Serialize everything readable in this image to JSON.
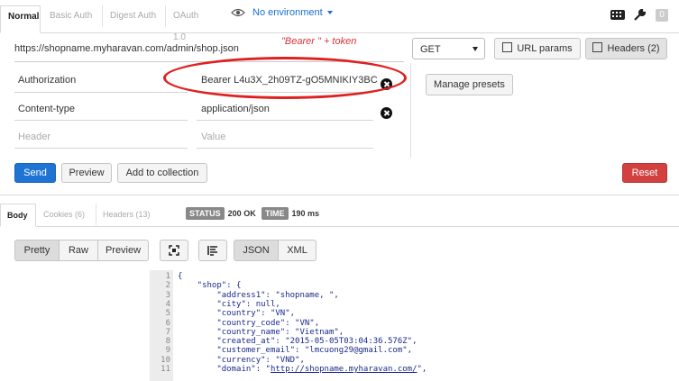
{
  "auth_tabs": [
    "Normal",
    "Basic Auth",
    "Digest Auth",
    "OAuth 1.0"
  ],
  "environment": "No environment",
  "top_badge": "0",
  "url": "https://shopname.myharavan.com/admin/shop.json",
  "annotation": "\"Bearer \" + token",
  "method": "GET",
  "url_params_label": "URL params",
  "headers_label": "Headers (2)",
  "manage_presets_label": "Manage presets",
  "headers": [
    {
      "key": "Authorization",
      "value": "Bearer L4u3X_2h09TZ-gO5MNIKIY3BC"
    },
    {
      "key": "Content-type",
      "value": "application/json"
    }
  ],
  "new_header": {
    "key_placeholder": "Header",
    "value_placeholder": "Value"
  },
  "actions": {
    "send": "Send",
    "preview": "Preview",
    "add_to_collection": "Add to collection",
    "reset": "Reset"
  },
  "response_tabs": [
    "Body",
    "Cookies (6)",
    "Headers (13)"
  ],
  "status": {
    "status_label": "STATUS",
    "status_value": "200 OK",
    "time_label": "TIME",
    "time_value": "190 ms"
  },
  "view_modes": [
    "Pretty",
    "Raw",
    "Preview"
  ],
  "formats": [
    "JSON",
    "XML"
  ],
  "code_lines": [
    {
      "n": "1",
      "text": "{"
    },
    {
      "n": "2",
      "text": "    \"shop\": {"
    },
    {
      "n": "3",
      "text": "        \"address1\": \"shopname, \","
    },
    {
      "n": "4",
      "text": "        \"city\": null,"
    },
    {
      "n": "5",
      "text": "        \"country\": \"VN\","
    },
    {
      "n": "6",
      "text": "        \"country_code\": \"VN\","
    },
    {
      "n": "7",
      "text": "        \"country_name\": \"Vietnam\","
    },
    {
      "n": "8",
      "text": "        \"created_at\": \"2015-05-05T03:04:36.576Z\","
    },
    {
      "n": "9",
      "text": "        \"customer_email\": \"lmcuong29@gmail.com\","
    },
    {
      "n": "10",
      "text": "        \"currency\": \"VND\","
    },
    {
      "n": "11",
      "text": "        \"domain\": \"http://shopname.myharavan.com/\","
    }
  ],
  "colors": {
    "accent": "#1e73d3",
    "danger": "#d24040",
    "annotation": "#e02020"
  }
}
